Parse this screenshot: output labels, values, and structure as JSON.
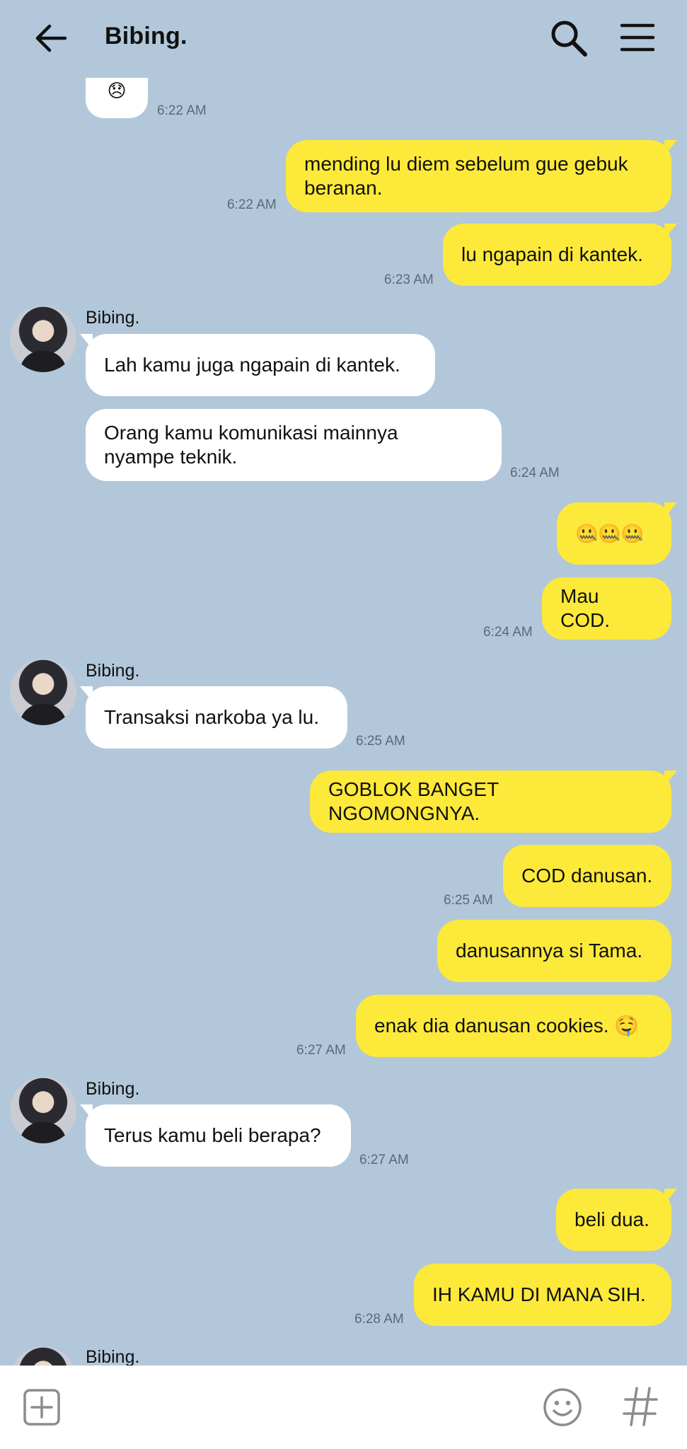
{
  "header": {
    "title": "Bibing.",
    "back_icon": "back-arrow-icon",
    "search_icon": "search-icon",
    "menu_icon": "menu-icon"
  },
  "partial_top": {
    "emoji": "😞",
    "time": "6:22 AM"
  },
  "messages": {
    "m1": {
      "text": "mending lu diem sebelum gue gebuk\nberanan.",
      "time": "6:22 AM"
    },
    "m2": {
      "text": "lu ngapain di kantek.",
      "time": "6:23 AM"
    },
    "m3": {
      "sender": "Bibing.",
      "text": "Lah kamu juga ngapain di kantek."
    },
    "m4": {
      "text": "Orang kamu komunikasi mainnya\nnyampe teknik.",
      "time": "6:24 AM"
    },
    "m5": {
      "text": "🤐🤐🤐"
    },
    "m6": {
      "text": "Mau COD.",
      "time": "6:24 AM"
    },
    "m7": {
      "sender": "Bibing.",
      "text": "Transaksi narkoba ya lu.",
      "time": "6:25 AM"
    },
    "m8": {
      "text": "GOBLOK BANGET NGOMONGNYA."
    },
    "m9": {
      "text": "COD danusan.",
      "time": "6:25 AM"
    },
    "m10": {
      "text": "danusannya si Tama."
    },
    "m11": {
      "text": "enak dia danusan cookies. 🤤",
      "time": "6:27 AM"
    },
    "m12": {
      "sender": "Bibing.",
      "text": "Terus kamu beli berapa?",
      "time": "6:27 AM"
    },
    "m13": {
      "text": "beli dua."
    },
    "m14": {
      "text": "IH KAMU DI MANA SIH.",
      "time": "6:28 AM"
    },
    "m15": {
      "sender": "Bibing."
    }
  },
  "input_bar": {
    "plus_icon": "plus-square-icon",
    "emoji_icon": "emoji-icon",
    "hash_icon": "hashtag-icon"
  },
  "colors": {
    "background": "#b2c7da",
    "outgoing_bubble": "#fde93a",
    "incoming_bubble": "#ffffff",
    "timestamp": "#5b6977"
  }
}
